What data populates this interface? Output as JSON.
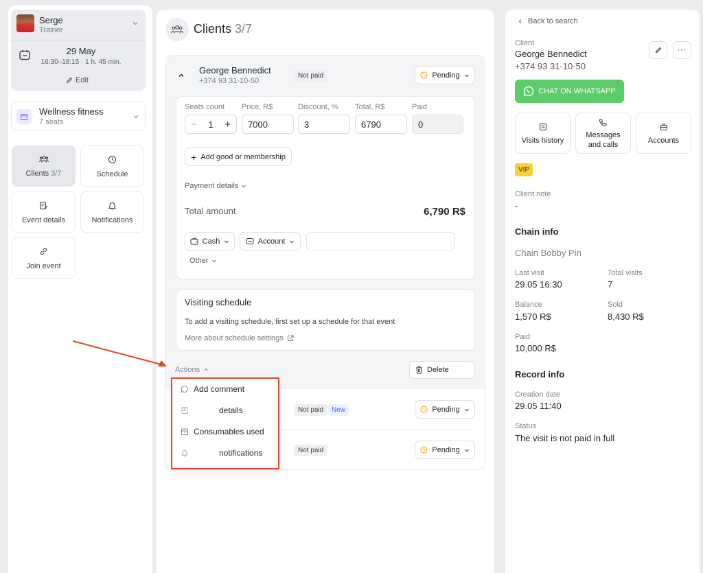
{
  "trainer": {
    "name": "Serge",
    "role": "Trainer"
  },
  "event_time": {
    "date": "29 May",
    "time": "16:30–18:15 · 1 h. 45 min.",
    "edit_label": "Edit"
  },
  "service": {
    "name": "Wellness fitness",
    "seats": "7 seats"
  },
  "nav": {
    "clients_label": "Clients",
    "clients_count": "3/7",
    "schedule": "Schedule",
    "event_details": "Event details",
    "notifications": "Notifications",
    "join_event": "Join event"
  },
  "main": {
    "title": "Clients",
    "count": "3/7"
  },
  "client_card": {
    "name": "George Bennedict",
    "phone": "+374 93 31-10-50",
    "payment_badge": "Not paid",
    "status": "Pending",
    "labels": {
      "seats": "Seats count",
      "price": "Price, R$",
      "discount": "Discount, %",
      "total": "Total, R$",
      "paid": "Paid"
    },
    "values": {
      "seats": "1",
      "price": "7000",
      "discount": "3",
      "total": "6790",
      "paid": "0"
    },
    "add_good_label": "Add good or membership",
    "payment_details": "Payment details",
    "total_amount_label": "Total amount",
    "total_amount_value": "6,790 R$",
    "cash_label": "Cash",
    "account_label": "Account",
    "other_label": "Other"
  },
  "visiting": {
    "title": "Visiting schedule",
    "text": "To add a visiting schedule, first set up a schedule for that event",
    "link": "More about schedule settings"
  },
  "actions": {
    "label": "Actions",
    "delete_label": "Delete",
    "menu": [
      "Add comment",
      "details",
      "Consumables used",
      "notifications"
    ]
  },
  "other_clients": [
    {
      "payment_badge": "Not paid",
      "new_badge": "New",
      "status": "Pending"
    },
    {
      "payment_badge": "Not paid",
      "status": "Pending"
    }
  ],
  "right": {
    "back": "Back to search",
    "client_label": "Client",
    "client_name": "George Bennedict",
    "client_phone": "+374 93 31-10-50",
    "whatsapp": "CHAT ON WHATSAPP",
    "tiles": [
      "Visits history",
      "Messages and calls",
      "Accounts"
    ],
    "vip": "VIP",
    "note_label": "Client note",
    "note_value": "-",
    "chain_title": "Chain info",
    "chain_name": "Chain Bobby Pin",
    "last_visit_label": "Last visit",
    "last_visit_value": "29.05 16:30",
    "total_visits_label": "Total visits",
    "total_visits_value": "7",
    "balance_label": "Balance",
    "balance_value": "1,570 R$",
    "sold_label": "Sold",
    "sold_value": "8,430 R$",
    "paid_label": "Paid",
    "paid_value": "10,000 R$",
    "record_title": "Record info",
    "creation_label": "Creation date",
    "creation_value": "29.05 11:40",
    "status_label": "Status",
    "status_value": "The visit is not paid in full"
  },
  "colors": {
    "whatsapp": "#5ccc68",
    "vip": "#f6d13a",
    "new_badge": "#2f6bff",
    "pending_icon": "#f2a52b",
    "annotation": "#e2452b"
  }
}
